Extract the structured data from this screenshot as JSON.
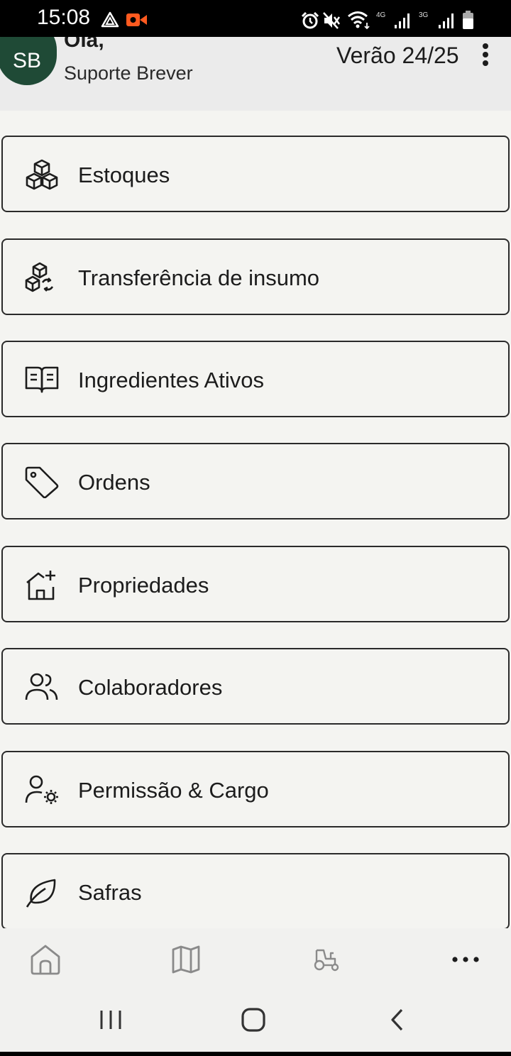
{
  "status_bar": {
    "time": "15:08",
    "net_4g": "4G",
    "net_3g": "3G",
    "icons": [
      "drive-icon",
      "video-record-icon",
      "alarm-icon",
      "mute-icon",
      "wifi-icon",
      "signal-icon",
      "battery-icon"
    ],
    "record_color": "#ff5a1f"
  },
  "header": {
    "avatar_initials": "SB",
    "greeting": "Olá,",
    "user_name": "Suporte Brever",
    "season": "Verão 24/25",
    "avatar_color": "#1f4a36"
  },
  "menu": {
    "items": [
      {
        "label": "Estoques",
        "icon": "cubes-icon"
      },
      {
        "label": "Transferência de insumo",
        "icon": "cubes-transfer-icon"
      },
      {
        "label": "Ingredientes Ativos",
        "icon": "book-open-icon"
      },
      {
        "label": "Ordens",
        "icon": "tag-icon"
      },
      {
        "label": "Propriedades",
        "icon": "house-plus-icon"
      },
      {
        "label": "Colaboradores",
        "icon": "users-icon"
      },
      {
        "label": "Permissão & Cargo",
        "icon": "user-gear-icon"
      },
      {
        "label": "Safras",
        "icon": "leaf-icon"
      }
    ]
  },
  "bottom_nav": {
    "items": [
      "home-icon",
      "map-icon",
      "tractor-icon",
      "more-icon"
    ],
    "icon_color": "#8a8a8a"
  },
  "system_nav": {
    "items": [
      "recent-apps-icon",
      "home-circle-icon",
      "back-icon"
    ]
  }
}
